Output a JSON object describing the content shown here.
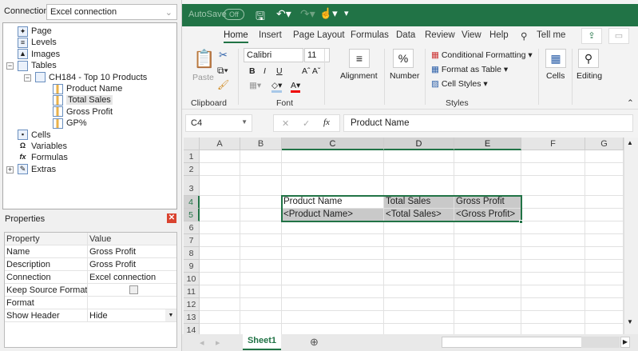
{
  "left": {
    "connection_label": "Connection",
    "connection_value": "Excel connection",
    "tree": [
      {
        "label": "Page",
        "icon": "page-icon",
        "level": 0
      },
      {
        "label": "Levels",
        "icon": "levels-icon",
        "level": 0
      },
      {
        "label": "Images",
        "icon": "images-icon",
        "level": 0
      },
      {
        "label": "Tables",
        "icon": "table-icon",
        "level": 0,
        "expander": "−"
      },
      {
        "label": "CH184 - Top 10 Products",
        "icon": "table-icon",
        "level": 1,
        "expander": "−"
      },
      {
        "label": "Product Name",
        "icon": "column-icon",
        "level": 2
      },
      {
        "label": "Total Sales",
        "icon": "column-icon",
        "level": 2,
        "selected": true
      },
      {
        "label": "Gross Profit",
        "icon": "column-icon",
        "level": 2
      },
      {
        "label": "GP%",
        "icon": "column-icon",
        "level": 2
      },
      {
        "label": "Cells",
        "icon": "cells-icon",
        "level": 0
      },
      {
        "label": "Variables",
        "icon": "omega-icon",
        "level": 0
      },
      {
        "label": "Formulas",
        "icon": "fx-icon",
        "level": 0
      },
      {
        "label": "Extras",
        "icon": "extras-icon",
        "level": 0,
        "expander": "+"
      }
    ],
    "properties_title": "Properties",
    "properties_header": [
      "Property",
      "Value"
    ],
    "properties": [
      {
        "k": "Name",
        "v": "Gross Profit"
      },
      {
        "k": "Description",
        "v": "Gross Profit"
      },
      {
        "k": "Connection",
        "v": "Excel connection"
      },
      {
        "k": "Keep Source Formats",
        "v": "",
        "checkbox": false
      },
      {
        "k": "Format",
        "v": ""
      },
      {
        "k": "Show Header",
        "v": "Hide",
        "dropdown": true
      }
    ]
  },
  "excel": {
    "autosave": "AutoSave",
    "autosave_state": "Off",
    "tabs": [
      "Home",
      "Insert",
      "Page Layout",
      "Formulas",
      "Data",
      "Review",
      "View",
      "Help"
    ],
    "active_tab": "Home",
    "tell_me": "Tell me",
    "ribbon": {
      "paste": "Paste",
      "clipboard": "Clipboard",
      "font_name": "Calibri",
      "font_size": "11",
      "font": "Font",
      "bold": "B",
      "italic": "I",
      "underline": "U",
      "alignment": "Alignment",
      "number": "Number",
      "percent": "%",
      "conditional_formatting": "Conditional Formatting",
      "format_as_table": "Format as Table",
      "cell_styles": "Cell Styles",
      "styles": "Styles",
      "cells": "Cells",
      "editing": "Editing"
    },
    "name_box": "C4",
    "formula": "Product Name",
    "columns": [
      "A",
      "B",
      "C",
      "D",
      "E",
      "F",
      "G"
    ],
    "rows": [
      "1",
      "2",
      "3",
      "4",
      "5",
      "6",
      "7",
      "8",
      "9",
      "10",
      "11",
      "12",
      "13",
      "14"
    ],
    "cells": {
      "C4": "Product Name",
      "D4": "Total Sales",
      "E4": "Gross Profit",
      "C5": "<Product Name>",
      "D5": "<Total Sales>",
      "E5": "<Gross Profit>"
    },
    "sheet_tab": "Sheet1",
    "accent": "#217346"
  }
}
